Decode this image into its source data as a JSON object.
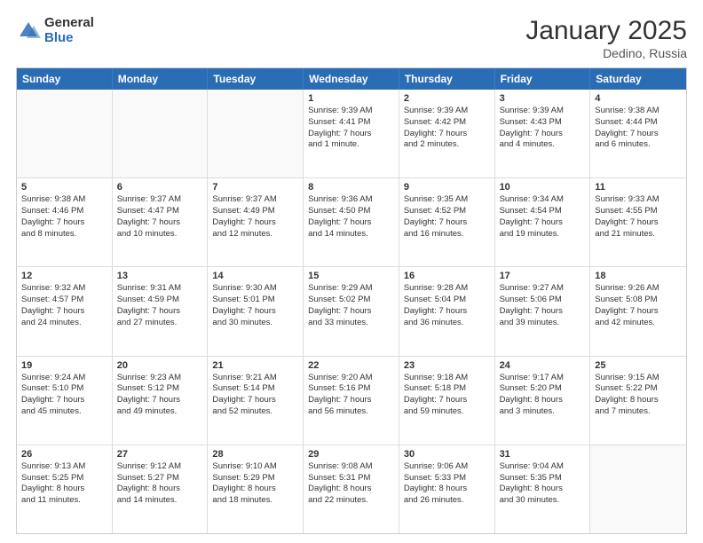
{
  "header": {
    "logo_general": "General",
    "logo_blue": "Blue",
    "month_title": "January 2025",
    "location": "Dedino, Russia"
  },
  "weekdays": [
    "Sunday",
    "Monday",
    "Tuesday",
    "Wednesday",
    "Thursday",
    "Friday",
    "Saturday"
  ],
  "rows": [
    [
      {
        "day": "",
        "empty": true,
        "lines": []
      },
      {
        "day": "",
        "empty": true,
        "lines": []
      },
      {
        "day": "",
        "empty": true,
        "lines": []
      },
      {
        "day": "1",
        "lines": [
          "Sunrise: 9:39 AM",
          "Sunset: 4:41 PM",
          "Daylight: 7 hours",
          "and 1 minute."
        ]
      },
      {
        "day": "2",
        "lines": [
          "Sunrise: 9:39 AM",
          "Sunset: 4:42 PM",
          "Daylight: 7 hours",
          "and 2 minutes."
        ]
      },
      {
        "day": "3",
        "lines": [
          "Sunrise: 9:39 AM",
          "Sunset: 4:43 PM",
          "Daylight: 7 hours",
          "and 4 minutes."
        ]
      },
      {
        "day": "4",
        "lines": [
          "Sunrise: 9:38 AM",
          "Sunset: 4:44 PM",
          "Daylight: 7 hours",
          "and 6 minutes."
        ]
      }
    ],
    [
      {
        "day": "5",
        "lines": [
          "Sunrise: 9:38 AM",
          "Sunset: 4:46 PM",
          "Daylight: 7 hours",
          "and 8 minutes."
        ]
      },
      {
        "day": "6",
        "lines": [
          "Sunrise: 9:37 AM",
          "Sunset: 4:47 PM",
          "Daylight: 7 hours",
          "and 10 minutes."
        ]
      },
      {
        "day": "7",
        "lines": [
          "Sunrise: 9:37 AM",
          "Sunset: 4:49 PM",
          "Daylight: 7 hours",
          "and 12 minutes."
        ]
      },
      {
        "day": "8",
        "lines": [
          "Sunrise: 9:36 AM",
          "Sunset: 4:50 PM",
          "Daylight: 7 hours",
          "and 14 minutes."
        ]
      },
      {
        "day": "9",
        "lines": [
          "Sunrise: 9:35 AM",
          "Sunset: 4:52 PM",
          "Daylight: 7 hours",
          "and 16 minutes."
        ]
      },
      {
        "day": "10",
        "lines": [
          "Sunrise: 9:34 AM",
          "Sunset: 4:54 PM",
          "Daylight: 7 hours",
          "and 19 minutes."
        ]
      },
      {
        "day": "11",
        "lines": [
          "Sunrise: 9:33 AM",
          "Sunset: 4:55 PM",
          "Daylight: 7 hours",
          "and 21 minutes."
        ]
      }
    ],
    [
      {
        "day": "12",
        "lines": [
          "Sunrise: 9:32 AM",
          "Sunset: 4:57 PM",
          "Daylight: 7 hours",
          "and 24 minutes."
        ]
      },
      {
        "day": "13",
        "lines": [
          "Sunrise: 9:31 AM",
          "Sunset: 4:59 PM",
          "Daylight: 7 hours",
          "and 27 minutes."
        ]
      },
      {
        "day": "14",
        "lines": [
          "Sunrise: 9:30 AM",
          "Sunset: 5:01 PM",
          "Daylight: 7 hours",
          "and 30 minutes."
        ]
      },
      {
        "day": "15",
        "lines": [
          "Sunrise: 9:29 AM",
          "Sunset: 5:02 PM",
          "Daylight: 7 hours",
          "and 33 minutes."
        ]
      },
      {
        "day": "16",
        "lines": [
          "Sunrise: 9:28 AM",
          "Sunset: 5:04 PM",
          "Daylight: 7 hours",
          "and 36 minutes."
        ]
      },
      {
        "day": "17",
        "lines": [
          "Sunrise: 9:27 AM",
          "Sunset: 5:06 PM",
          "Daylight: 7 hours",
          "and 39 minutes."
        ]
      },
      {
        "day": "18",
        "lines": [
          "Sunrise: 9:26 AM",
          "Sunset: 5:08 PM",
          "Daylight: 7 hours",
          "and 42 minutes."
        ]
      }
    ],
    [
      {
        "day": "19",
        "lines": [
          "Sunrise: 9:24 AM",
          "Sunset: 5:10 PM",
          "Daylight: 7 hours",
          "and 45 minutes."
        ]
      },
      {
        "day": "20",
        "lines": [
          "Sunrise: 9:23 AM",
          "Sunset: 5:12 PM",
          "Daylight: 7 hours",
          "and 49 minutes."
        ]
      },
      {
        "day": "21",
        "lines": [
          "Sunrise: 9:21 AM",
          "Sunset: 5:14 PM",
          "Daylight: 7 hours",
          "and 52 minutes."
        ]
      },
      {
        "day": "22",
        "lines": [
          "Sunrise: 9:20 AM",
          "Sunset: 5:16 PM",
          "Daylight: 7 hours",
          "and 56 minutes."
        ]
      },
      {
        "day": "23",
        "lines": [
          "Sunrise: 9:18 AM",
          "Sunset: 5:18 PM",
          "Daylight: 7 hours",
          "and 59 minutes."
        ]
      },
      {
        "day": "24",
        "lines": [
          "Sunrise: 9:17 AM",
          "Sunset: 5:20 PM",
          "Daylight: 8 hours",
          "and 3 minutes."
        ]
      },
      {
        "day": "25",
        "lines": [
          "Sunrise: 9:15 AM",
          "Sunset: 5:22 PM",
          "Daylight: 8 hours",
          "and 7 minutes."
        ]
      }
    ],
    [
      {
        "day": "26",
        "lines": [
          "Sunrise: 9:13 AM",
          "Sunset: 5:25 PM",
          "Daylight: 8 hours",
          "and 11 minutes."
        ]
      },
      {
        "day": "27",
        "lines": [
          "Sunrise: 9:12 AM",
          "Sunset: 5:27 PM",
          "Daylight: 8 hours",
          "and 14 minutes."
        ]
      },
      {
        "day": "28",
        "lines": [
          "Sunrise: 9:10 AM",
          "Sunset: 5:29 PM",
          "Daylight: 8 hours",
          "and 18 minutes."
        ]
      },
      {
        "day": "29",
        "lines": [
          "Sunrise: 9:08 AM",
          "Sunset: 5:31 PM",
          "Daylight: 8 hours",
          "and 22 minutes."
        ]
      },
      {
        "day": "30",
        "lines": [
          "Sunrise: 9:06 AM",
          "Sunset: 5:33 PM",
          "Daylight: 8 hours",
          "and 26 minutes."
        ]
      },
      {
        "day": "31",
        "lines": [
          "Sunrise: 9:04 AM",
          "Sunset: 5:35 PM",
          "Daylight: 8 hours",
          "and 30 minutes."
        ]
      },
      {
        "day": "",
        "empty": true,
        "lines": []
      }
    ]
  ]
}
